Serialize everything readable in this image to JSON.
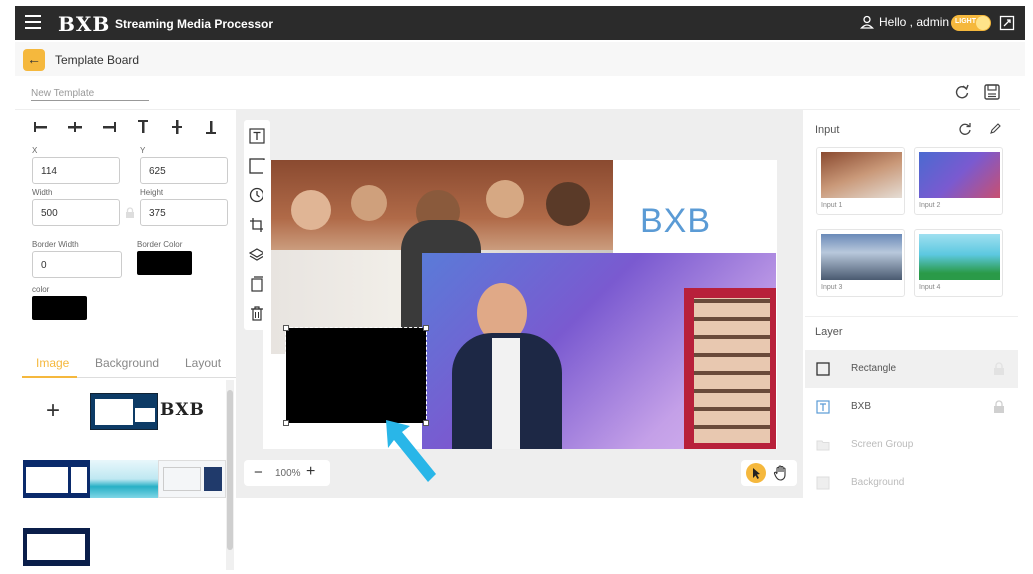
{
  "app": {
    "logo": "BXB",
    "title": "Streaming Media Processor",
    "user_greeting": "Hello , admin",
    "theme_label": "LIGHT"
  },
  "page": {
    "title": "Template Board",
    "template_name_placeholder": "New Template"
  },
  "properties": {
    "x_label": "X",
    "x_value": "114",
    "y_label": "Y",
    "y_value": "625",
    "width_label": "Width",
    "width_value": "500",
    "height_label": "Height",
    "height_value": "375",
    "border_width_label": "Border Width",
    "border_width_value": "0",
    "border_color_label": "Border Color",
    "border_color": "#000000",
    "color_label": "color",
    "color": "#000000"
  },
  "left_tabs": [
    {
      "label": "Image",
      "active": true
    },
    {
      "label": "Background",
      "active": false
    },
    {
      "label": "Layout",
      "active": false
    }
  ],
  "image_library": {
    "add_label": "+",
    "logo_text": "BXB"
  },
  "canvas": {
    "text_element": "BXB",
    "zoom": "100%",
    "zoom_out": "−",
    "zoom_in": "+"
  },
  "input_panel": {
    "title": "Input",
    "inputs": [
      {
        "label": "Input 1"
      },
      {
        "label": "Input 2"
      },
      {
        "label": "Input 3"
      },
      {
        "label": "Input 4"
      }
    ]
  },
  "layer_panel": {
    "title": "Layer",
    "layers": [
      {
        "name": "Rectangle",
        "selected": true,
        "icon": "square-icon"
      },
      {
        "name": "BXB",
        "selected": false,
        "icon": "text-icon"
      },
      {
        "name": "Screen Group",
        "selected": false,
        "icon": "folder-icon"
      },
      {
        "name": "Background",
        "selected": false,
        "icon": "image-icon"
      }
    ]
  },
  "colors": {
    "accent": "#f5b83d",
    "topbar": "#2b2b2b",
    "bxb_text": "#5b9bd5",
    "annotation_arrow": "#29b6e8"
  }
}
